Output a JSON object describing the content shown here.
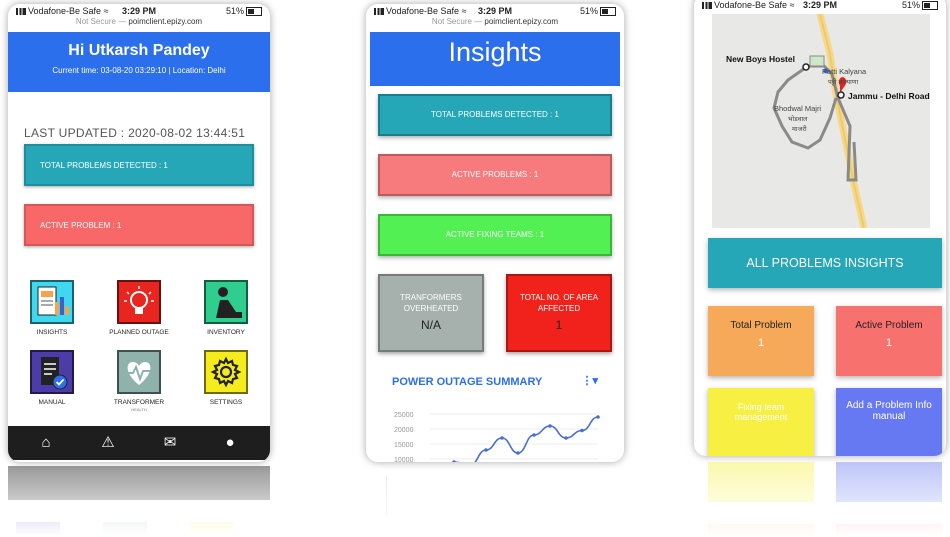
{
  "status_bar": {
    "carrier": "Vodafone-Be Safe",
    "time": "3:29 PM",
    "battery": "51%",
    "not_secure": "Not Secure —",
    "domain": "poimclient.epizy.com"
  },
  "phone1": {
    "greeting": "Hi Utkarsh Pandey",
    "subheader": "Current time: 03-08-20 03:29:10 | Location: Delhi",
    "last_updated": "LAST UPDATED : 2020-08-02 13:44:51",
    "total_problems": "TOTAL PROBLEMS DETECTED : 1",
    "active_problem": "ACTIVE PROBLEM : 1",
    "grid": [
      {
        "label": "INSIGHTS",
        "icon": "insights-chart-icon",
        "color": "#3fd8f0"
      },
      {
        "label": "PLANNED OUTAGE",
        "icon": "bulb-icon",
        "color": "#e8251f"
      },
      {
        "label": "INVENTORY",
        "icon": "worker-icon",
        "color": "#2fce8e"
      },
      {
        "label": "MANUAL",
        "icon": "manual-book-icon",
        "color": "#4b3ca8"
      },
      {
        "label": "TRANSFORMER",
        "sublabel": "HEALTH",
        "icon": "heartbeat-icon",
        "color": "#8fb2ad"
      },
      {
        "label": "SETTINGS",
        "icon": "gear-icon",
        "color": "#f5ec1e"
      }
    ],
    "nav": [
      "home-icon",
      "alert-icon",
      "mail-icon",
      "user-icon"
    ]
  },
  "phone2": {
    "title": "Insights",
    "total_problems": "TOTAL PROBLEMS DETECTED : 1",
    "active_problems": "ACTIVE PROBLEMS : 1",
    "active_fixing": "ACTIVE FIXING TEAMS : 1",
    "overheated_label": "TRANFORMERS OVERHEATED",
    "overheated_value": "N/A",
    "areas_label": "TOTAL NO. OF AREA AFFECTED",
    "areas_value": "1",
    "summary_title": "POWER OUTAGE SUMMARY",
    "chart_data": {
      "type": "line",
      "title": "POWER OUTAGE SUMMARY",
      "ylim": [
        10000,
        25000
      ],
      "yticks": [
        "25000",
        "20000",
        "15000",
        "10000"
      ],
      "series": [
        {
          "values": [
            9000,
            8000,
            13000,
            17000,
            12000,
            18000,
            21000,
            17000,
            19500,
            24000
          ]
        }
      ]
    },
    "colors": {
      "total": "#25a7b8",
      "active": "#f77b7c",
      "fixing": "#52f052",
      "overheated": "#a6b1ae",
      "areas": "#f1221c"
    }
  },
  "phone3": {
    "map": {
      "hostel": "New Boys Hostel",
      "patti": "Patti Kalyana",
      "patti_hindi": "पट्टी कल्याणा",
      "road": "Jammu - Delhi Road",
      "bhodwal": "Bhodwal Majri",
      "bhodwal_hindi_1": "भोडवाल",
      "bhodwal_hindi_2": "माजरी"
    },
    "all_insights": "ALL PROBLEMS INSIGHTS",
    "total_problem_label": "Total Problem",
    "total_problem_value": "1",
    "active_problem_label": "Active Problem",
    "active_problem_value": "1",
    "fixing_team": "Fixing team management",
    "add_problem": "Add a Problem Info manual",
    "colors": {
      "total": "#f7a95a",
      "active": "#f7716f",
      "fixing": "#f7f042",
      "add": "#6679f2"
    }
  }
}
